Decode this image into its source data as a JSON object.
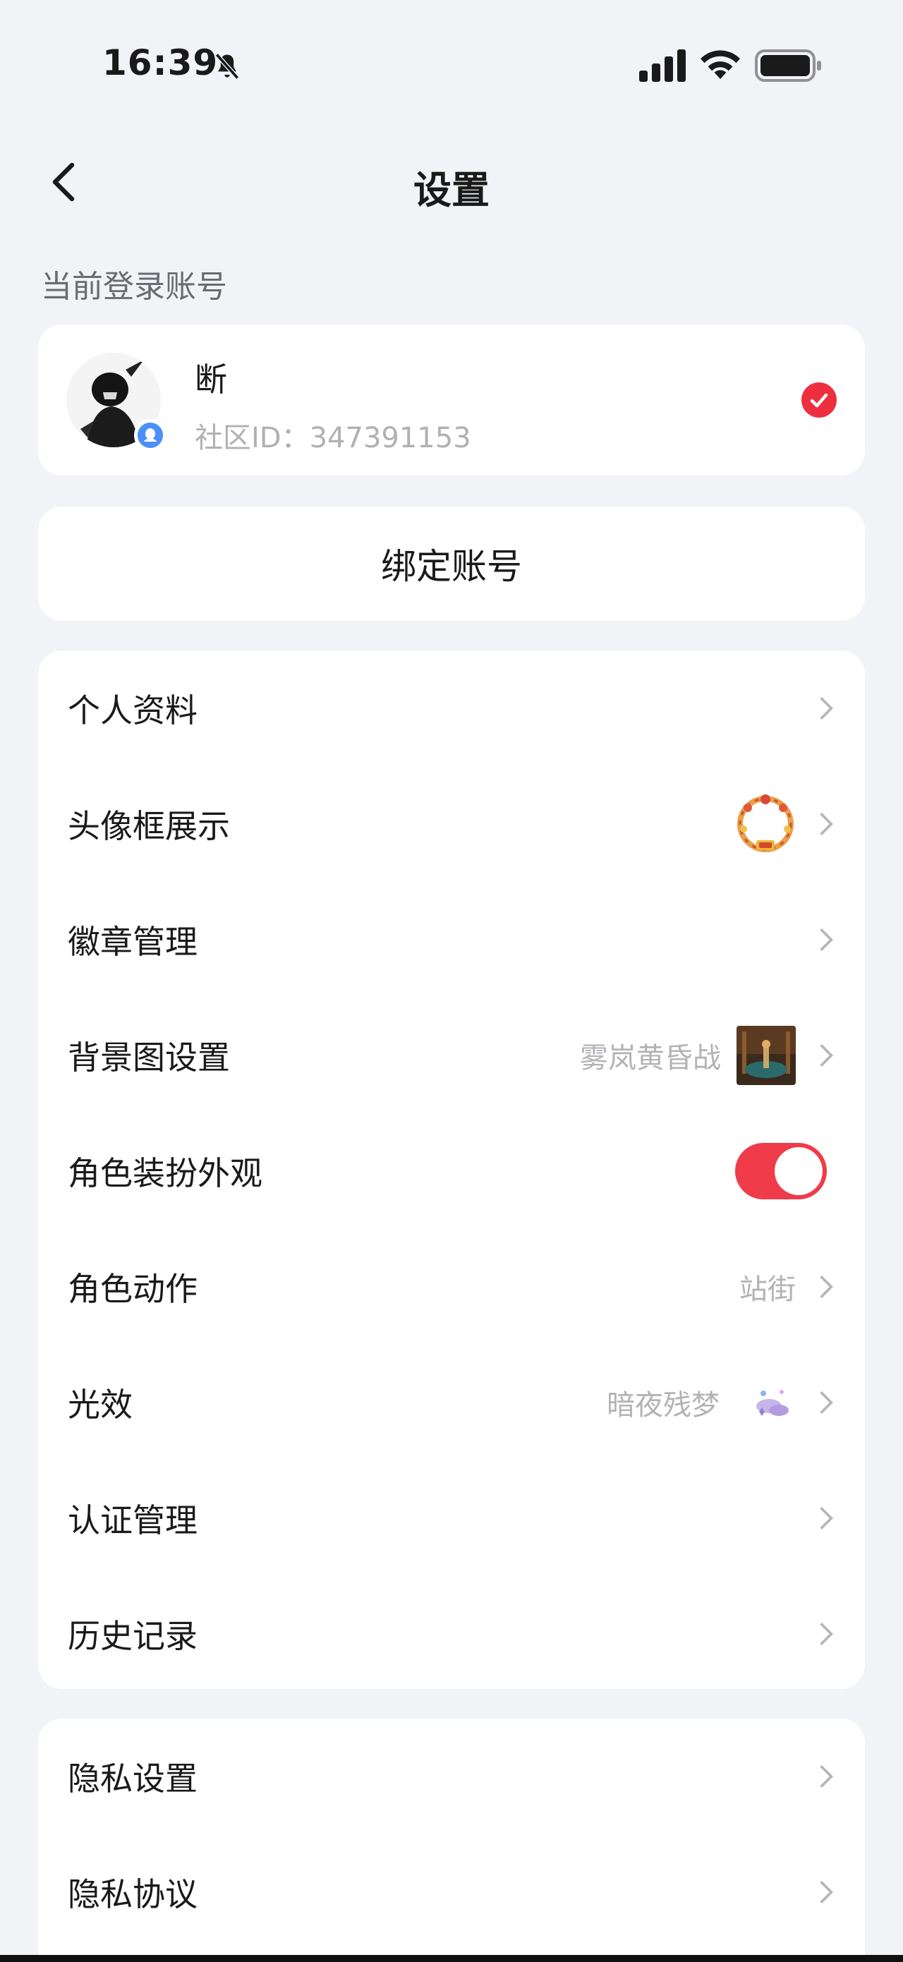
{
  "status_bar": {
    "time": "16:39"
  },
  "nav": {
    "title": "设置"
  },
  "current_account": {
    "section_label": "当前登录账号",
    "name": "断",
    "community_id": "社区ID：347391153"
  },
  "bind_account": {
    "label": "绑定账号"
  },
  "menu_group_1": [
    {
      "label": "个人资料"
    },
    {
      "label": "头像框展示"
    },
    {
      "label": "徽章管理"
    },
    {
      "label": "背景图设置",
      "value": "雾岚黄昏战"
    },
    {
      "label": "角色装扮外观",
      "toggle": "on"
    },
    {
      "label": "角色动作",
      "value": "站街"
    },
    {
      "label": "光效",
      "value": "暗夜残梦"
    },
    {
      "label": "认证管理"
    },
    {
      "label": "历史记录"
    }
  ],
  "menu_group_2": [
    {
      "label": "隐私设置"
    },
    {
      "label": "隐私协议"
    }
  ],
  "colors": {
    "accent": "#f03b4a",
    "background": "#f2f3f7",
    "card": "#ffffff",
    "muted": "#b2b2b7"
  },
  "icons": [
    "bell-muted-icon",
    "signal-icon",
    "wifi-icon",
    "battery-icon",
    "back-arrow-icon",
    "check-icon",
    "chevron-right-icon",
    "qq-badge-icon"
  ]
}
